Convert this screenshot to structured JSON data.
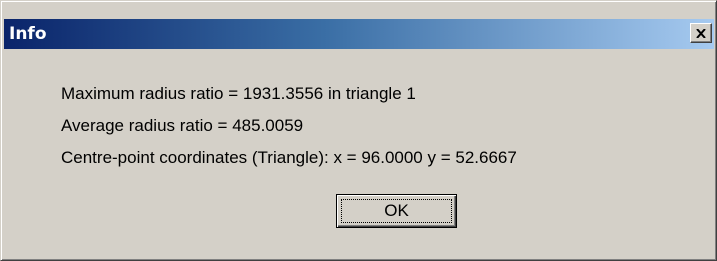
{
  "dialog": {
    "title": "Info",
    "close_icon": "close-icon",
    "messages": {
      "max_radius": "Maximum radius ratio = 1931.3556 in triangle 1",
      "avg_radius": "Average radius ratio = 485.0059",
      "centre_point": "Centre-point coordinates (Triangle): x = 96.0000  y = 52.6667"
    },
    "ok_label": "OK"
  },
  "colors": {
    "titlebar_start": "#0a246a",
    "titlebar_end": "#a6caf0",
    "face": "#d4d0c8"
  }
}
